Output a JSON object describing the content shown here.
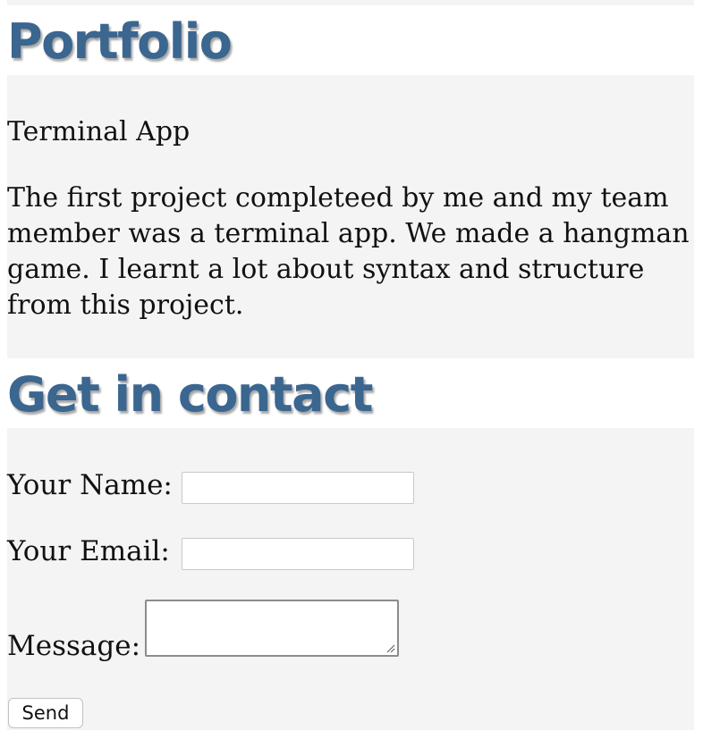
{
  "portfolio": {
    "heading": "Portfolio",
    "project_title": "Terminal App",
    "project_description": "The first project completeed by me and my team member was a terminal app. We made a hangman game. I learnt a lot about syntax and structure from this project."
  },
  "contact": {
    "heading": "Get in contact",
    "name_label": "Your Name:",
    "name_value": "",
    "email_label": "Your Email:",
    "email_value": "",
    "message_label": "Message:",
    "message_value": "",
    "send_label": "Send"
  },
  "colors": {
    "heading": "#3a6690",
    "panel_background": "#f4f4f4"
  },
  "icons": {
    "textarea_resize": "resize-grip-icon"
  }
}
